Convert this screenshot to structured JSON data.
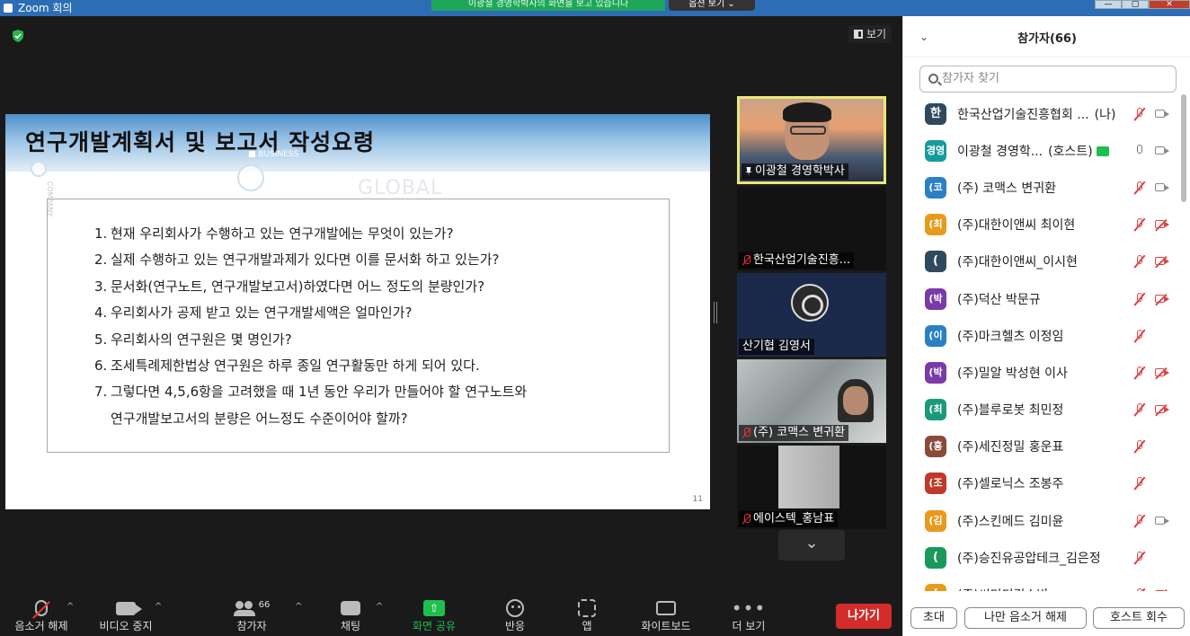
{
  "window": {
    "title": "Zoom 회의",
    "share_banner": "이광철 경영학박사의 화면을 보고 있습니다",
    "stop_share": "옵션 보기 ⌄",
    "minimize": "—",
    "maximize": "▢",
    "close": "✕"
  },
  "stage": {
    "view_label": "보기"
  },
  "slide": {
    "title": "연구개발계획서 및 보고서 작성요령",
    "deco_business": "■ BUSINESS",
    "deco_global": "GLOBAL",
    "deco_company": "COMPANY",
    "items": [
      {
        "num": "1.",
        "text": "현재 우리회사가 수행하고 있는 연구개발에는 무엇이 있는가?"
      },
      {
        "num": "2.",
        "text": "실제 수행하고 있는 연구개발과제가 있다면 이를 문서화 하고 있는가?"
      },
      {
        "num": "3.",
        "text": "문서화(연구노트, 연구개발보고서)하였다면 어느 정도의 분량인가?"
      },
      {
        "num": "4.",
        "text": "우리회사가 공제 받고 있는 연구개발세액은 얼마인가?"
      },
      {
        "num": "5.",
        "text": "우리회사의 연구원은 몇 명인가?"
      },
      {
        "num": "6.",
        "text": "조세특례제한법상 연구원은 하루 종일 연구활동만 하게 되어 있다."
      },
      {
        "num": "7.",
        "text": "그렇다면 4,5,6항을 고려했을 때 1년 동안 우리가 만들어야 할 연구노트와"
      }
    ],
    "item7_cont": "연구개발보고서의 분량은 어느정도 수준이어야 할까?",
    "page_num": "11"
  },
  "thumbnails": [
    {
      "label": "이광철 경영학박사"
    },
    {
      "label": "한국산업기술진흥..."
    },
    {
      "label": "산기협 김영서"
    },
    {
      "label": "(주) 코맥스 변귀환"
    },
    {
      "label": "에이스텍_홍남표"
    }
  ],
  "toolbar": {
    "unmute": "음소거 해제",
    "stop_video": "비디오 중지",
    "participants": "참가자",
    "participants_count": "66",
    "chat": "채팅",
    "share_screen": "화면 공유",
    "reactions": "반응",
    "apps": "앱",
    "whiteboard": "화이트보드",
    "more": "더 보기",
    "more_glyph": "•••",
    "leave": "나가기"
  },
  "panel": {
    "title": "참가자(66)",
    "search_placeholder": "참가자 찾기",
    "participants": [
      {
        "initial": "한",
        "name": "한국산업기술진흥협회 ...",
        "tag": "(나)",
        "color": "#2f4a5e",
        "mic": "muted",
        "cam": "on"
      },
      {
        "initial": "경영",
        "name": "이광철 경영학...",
        "tag": "(호스트)",
        "color": "#1a9a9a",
        "mic": "on",
        "cam": "on",
        "sharing": true
      },
      {
        "initial": "(코",
        "name": "(주) 코맥스 변귀환",
        "tag": "",
        "color": "#2a80c6",
        "mic": "muted",
        "cam": "on"
      },
      {
        "initial": "(최",
        "name": "(주)대한이앤씨 최이현",
        "tag": "",
        "color": "#e89a1a",
        "mic": "muted",
        "cam": "off"
      },
      {
        "initial": "(",
        "name": "(주)대한이앤씨_이시현",
        "tag": "",
        "color": "#2f4a5e",
        "mic": "muted",
        "cam": "off"
      },
      {
        "initial": "(박",
        "name": "(주)덕산 박문규",
        "tag": "",
        "color": "#7a3aa8",
        "mic": "muted",
        "cam": "off"
      },
      {
        "initial": "(이",
        "name": "(주)마크헬츠 이정임",
        "tag": "",
        "color": "#2a80c6",
        "mic": "muted",
        "cam": "none"
      },
      {
        "initial": "(박",
        "name": "(주)밀알 박성현 이사",
        "tag": "",
        "color": "#7a3aa8",
        "mic": "muted",
        "cam": "off"
      },
      {
        "initial": "(최",
        "name": "(주)블루로봇 최민정",
        "tag": "",
        "color": "#1a9a7a",
        "mic": "muted",
        "cam": "off"
      },
      {
        "initial": "(홍",
        "name": "(주)세진정밀 홍운표",
        "tag": "",
        "color": "#8a4a3a",
        "mic": "muted",
        "cam": "none"
      },
      {
        "initial": "(조",
        "name": "(주)셀로닉스 조봉주",
        "tag": "",
        "color": "#c0392b",
        "mic": "muted",
        "cam": "none"
      },
      {
        "initial": "(김",
        "name": "(주)스킨메드 김미윤",
        "tag": "",
        "color": "#e89a1a",
        "mic": "muted",
        "cam": "on"
      },
      {
        "initial": "(",
        "name": "(주)승진유공압테크_김은정",
        "tag": "",
        "color": "#1a9a5a",
        "mic": "muted",
        "cam": "none"
      },
      {
        "initial": "(",
        "name": "(주)씨디디김소빈",
        "tag": "",
        "color": "#e89a1a",
        "mic": "muted",
        "cam": "off"
      }
    ],
    "invite": "초대",
    "unmute_me": "나만 음소거 해제",
    "reclaim_host": "호스트 회수"
  },
  "colors": {
    "accent_green": "#1fbf4f",
    "leave_red": "#d42b2b",
    "active_border": "#e8e87a"
  }
}
